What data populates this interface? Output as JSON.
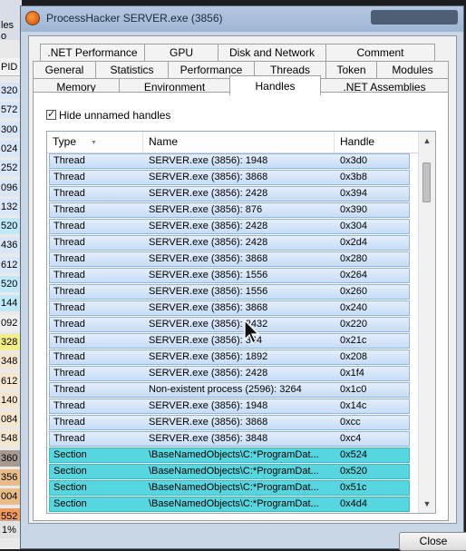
{
  "window": {
    "title": "ProcessHacker SERVER.exe (3856)"
  },
  "background": {
    "title_fragment": "les o",
    "column_header": "PID",
    "rows": [
      {
        "text": "320",
        "color": "#d9e6f7"
      },
      {
        "text": "572",
        "color": "#d9e6f7"
      },
      {
        "text": "300",
        "color": "#d9e6f7"
      },
      {
        "text": "024",
        "color": "#d9e6f7"
      },
      {
        "text": "252",
        "color": "#d9e6f7"
      },
      {
        "text": "096",
        "color": "#d9e6f7"
      },
      {
        "text": "132",
        "color": "#d9e6f7"
      },
      {
        "text": "520",
        "color": "#bfe8fb"
      },
      {
        "text": "436",
        "color": "#d9e6f7"
      },
      {
        "text": "612",
        "color": "#d9e6f7"
      },
      {
        "text": "520",
        "color": "#bfe8fb"
      },
      {
        "text": "144",
        "color": "#bfe8fb"
      },
      {
        "text": "092",
        "color": "#eeeeee"
      },
      {
        "text": "328",
        "color": "#f4ef86"
      },
      {
        "text": "348",
        "color": "#f5e6d0"
      },
      {
        "text": "612",
        "color": "#f5e6d0"
      },
      {
        "text": "140",
        "color": "#f5e6d0"
      },
      {
        "text": "084",
        "color": "#f5e6d0"
      },
      {
        "text": "548",
        "color": "#f5e6d0"
      },
      {
        "text": "360",
        "color": "#a99a91"
      },
      {
        "text": "356",
        "color": "#e9bc88"
      },
      {
        "text": "004",
        "color": "#e9bc88"
      },
      {
        "text": "552",
        "color": "#f19a5e"
      }
    ],
    "status": "1%"
  },
  "tabs_row1": [
    ".NET Performance",
    "GPU",
    "Disk and Network",
    "Comment"
  ],
  "tabs_row2": [
    "General",
    "Statistics",
    "Performance",
    "Threads",
    "Token",
    "Modules"
  ],
  "tabs_row3": [
    "Memory",
    "Environment",
    "Handles",
    ".NET Assemblies"
  ],
  "active_tab": "Handles",
  "hide_unnamed": {
    "label": "Hide unnamed handles",
    "checked": true
  },
  "list": {
    "columns": [
      "Type",
      "Name",
      "Handle"
    ],
    "rows": [
      {
        "type": "Thread",
        "name": "SERVER.exe (3856): 1948",
        "handle": "0x3d0"
      },
      {
        "type": "Thread",
        "name": "SERVER.exe (3856): 3868",
        "handle": "0x3b8"
      },
      {
        "type": "Thread",
        "name": "SERVER.exe (3856): 2428",
        "handle": "0x394"
      },
      {
        "type": "Thread",
        "name": "SERVER.exe (3856): 876",
        "handle": "0x390"
      },
      {
        "type": "Thread",
        "name": "SERVER.exe (3856): 2428",
        "handle": "0x304"
      },
      {
        "type": "Thread",
        "name": "SERVER.exe (3856): 2428",
        "handle": "0x2d4"
      },
      {
        "type": "Thread",
        "name": "SERVER.exe (3856): 3868",
        "handle": "0x280"
      },
      {
        "type": "Thread",
        "name": "SERVER.exe (3856): 1556",
        "handle": "0x264"
      },
      {
        "type": "Thread",
        "name": "SERVER.exe (3856): 1556",
        "handle": "0x260"
      },
      {
        "type": "Thread",
        "name": "SERVER.exe (3856): 3868",
        "handle": "0x240"
      },
      {
        "type": "Thread",
        "name": "SERVER.exe (3856): 2432",
        "handle": "0x220"
      },
      {
        "type": "Thread",
        "name": "SERVER.exe (3856): 364",
        "handle": "0x21c"
      },
      {
        "type": "Thread",
        "name": "SERVER.exe (3856): 1892",
        "handle": "0x208"
      },
      {
        "type": "Thread",
        "name": "SERVER.exe (3856): 2428",
        "handle": "0x1f4"
      },
      {
        "type": "Thread",
        "name": "Non-existent process (2596): 3264",
        "handle": "0x1c0"
      },
      {
        "type": "Thread",
        "name": "SERVER.exe (3856): 1948",
        "handle": "0x14c"
      },
      {
        "type": "Thread",
        "name": "SERVER.exe (3856): 3868",
        "handle": "0xcc"
      },
      {
        "type": "Thread",
        "name": "SERVER.exe (3856): 3848",
        "handle": "0xc4"
      },
      {
        "type": "Section",
        "name": "\\BaseNamedObjects\\C:*ProgramDat...",
        "handle": "0x524"
      },
      {
        "type": "Section",
        "name": "\\BaseNamedObjects\\C:*ProgramDat...",
        "handle": "0x520"
      },
      {
        "type": "Section",
        "name": "\\BaseNamedObjects\\C:*ProgramDat...",
        "handle": "0x51c"
      },
      {
        "type": "Section",
        "name": "\\BaseNamedObjects\\C:*ProgramDat...",
        "handle": "0x4d4"
      }
    ]
  },
  "buttons": {
    "close": "Close"
  },
  "colors": {
    "thread_row": "#c8dcf5",
    "section_row": "#57d6df"
  }
}
